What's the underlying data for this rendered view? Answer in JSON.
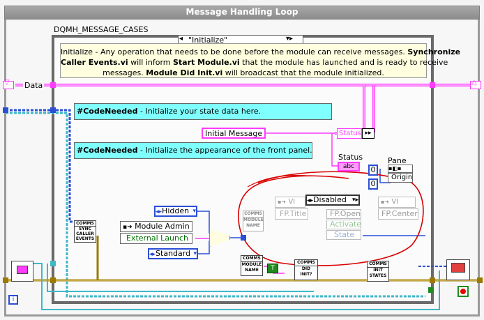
{
  "loop": {
    "title": "Message Handling Loop"
  },
  "case_structure": {
    "label": "DQMH_MESSAGE_CASES",
    "selector": "\"Initialize\"",
    "comment_line1_pre": "Initialize - Any operation that needs to be done before the module can receive messages. ",
    "comment_line1_bold": "Synchronize",
    "comment_line2_bold": "Caller Events.vi",
    "comment_line2_post": " will inform ",
    "comment_line2_bold2": "Start Module.vi",
    "comment_line2_post2": " that the module has launched and is ready to receive",
    "comment_line3_pre": "messages. ",
    "comment_line3_bold": "Module Did Init.vi",
    "comment_line3_post": " will broadcast that the module initialized."
  },
  "shift_register": {
    "label": "Data"
  },
  "notes": {
    "note1_tag": "#CodeNeeded",
    "note1_text": " - Initialize your state data here.",
    "note2_tag": "#CodeNeeded",
    "note2_text": " - Initialize the appearance of the front panel."
  },
  "constants": {
    "initial_message": "Initial Message",
    "status_label": "Status",
    "status_indicator_label": "Status",
    "status_indicator_value": "abc",
    "pane_label": "Pane",
    "origin_label": "Origin",
    "hidden": "Hidden",
    "standard": "Standard",
    "disabled": "Disabled",
    "zero1": "0",
    "zero2": "0",
    "true_const": "T"
  },
  "nodes": {
    "module_admin": "Module Admin",
    "external_launch": "External Launch",
    "fp_title": "FP.Title",
    "vi1": "VI",
    "vi2": "VI",
    "fp_open": "FP.Open",
    "activate": "Activate",
    "state": "State",
    "fp_center": "FP.Center",
    "sync_caller": [
      "COMMS",
      "SYNC",
      "CALLER",
      "EVENTS"
    ],
    "module_name1": [
      "COMMS",
      "MODULE",
      "NAME"
    ],
    "module_name2": [
      "COMMS",
      "MODULE",
      "NAME"
    ],
    "did_init": [
      "COMMS",
      "DID",
      "INIT?"
    ],
    "init_states": [
      "COMMS",
      "INIT",
      "STATES"
    ]
  },
  "loop_index": "i",
  "colors": {
    "loop_border": "#9a9a9a",
    "case_border": "#6a6a6a",
    "note_yellow": "#ffffe0",
    "note_cyan": "#80ffff",
    "wire_pink": "#ff3bff",
    "wire_blue": "#2b4fd6",
    "wire_cyan": "#3fb8c8",
    "wire_brown": "#9a7a00",
    "annotation_red": "#d80000"
  }
}
